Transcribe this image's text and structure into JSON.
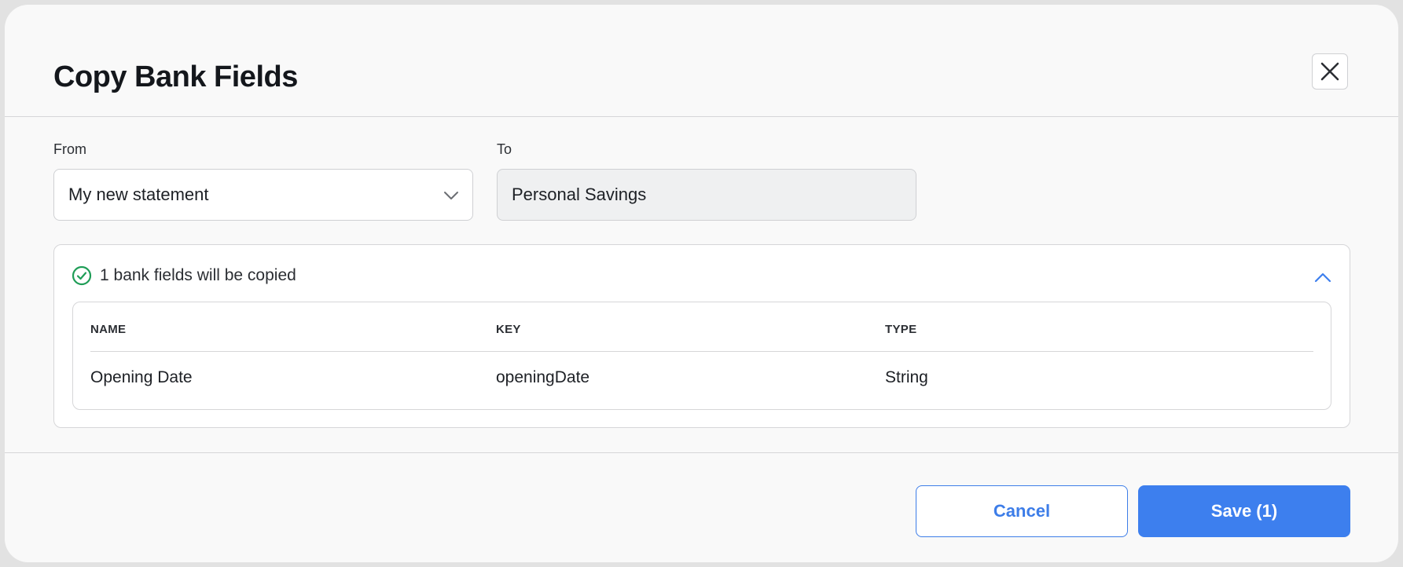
{
  "dialog": {
    "title": "Copy Bank Fields",
    "close_icon": "close-icon"
  },
  "from": {
    "label": "From",
    "value": "My new statement",
    "icon": "chevron-down-icon"
  },
  "to": {
    "label": "To",
    "value": "Personal Savings"
  },
  "summary": {
    "text": "1 bank fields will be copied",
    "status_icon": "check-circle-icon",
    "toggle_icon": "chevron-up-icon",
    "expanded": true
  },
  "table": {
    "columns": [
      "NAME",
      "KEY",
      "TYPE"
    ],
    "rows": [
      [
        "Opening Date",
        "openingDate",
        "String"
      ]
    ]
  },
  "footer": {
    "cancel_label": "Cancel",
    "save_label": "Save (1)"
  },
  "colors": {
    "primary": "#3d7fee",
    "success": "#1f9d57",
    "text": "#14171c"
  }
}
